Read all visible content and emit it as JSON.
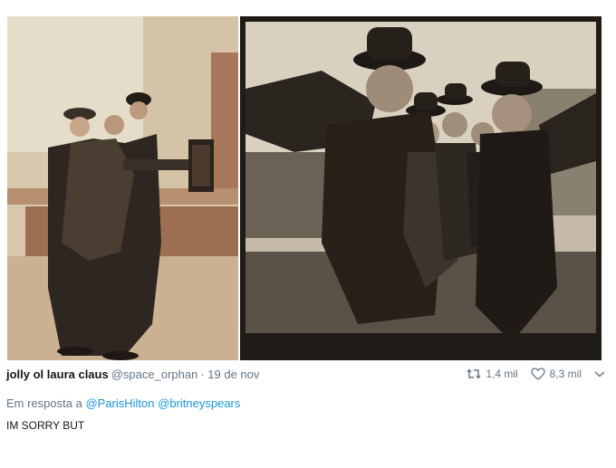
{
  "tweet": {
    "author_name": "jolly ol laura claus",
    "author_handle": "@space_orphan",
    "date": "· 19 de nov",
    "retweets": "1,4 mil",
    "likes": "8,3 mil",
    "reply_prefix": "Em resposta a",
    "reply_mention_1": "@ParisHilton",
    "reply_mention_2": "@britneyspears",
    "text": "IM SORRY BUT"
  },
  "icons": {
    "retweet": "retweet-icon",
    "like": "heart-icon",
    "more": "chevron-down-icon"
  },
  "colors": {
    "link": "#1b95e0",
    "muted": "#657786",
    "sepia_light": "#cbb9a0",
    "sepia_dark": "#2b2620"
  }
}
